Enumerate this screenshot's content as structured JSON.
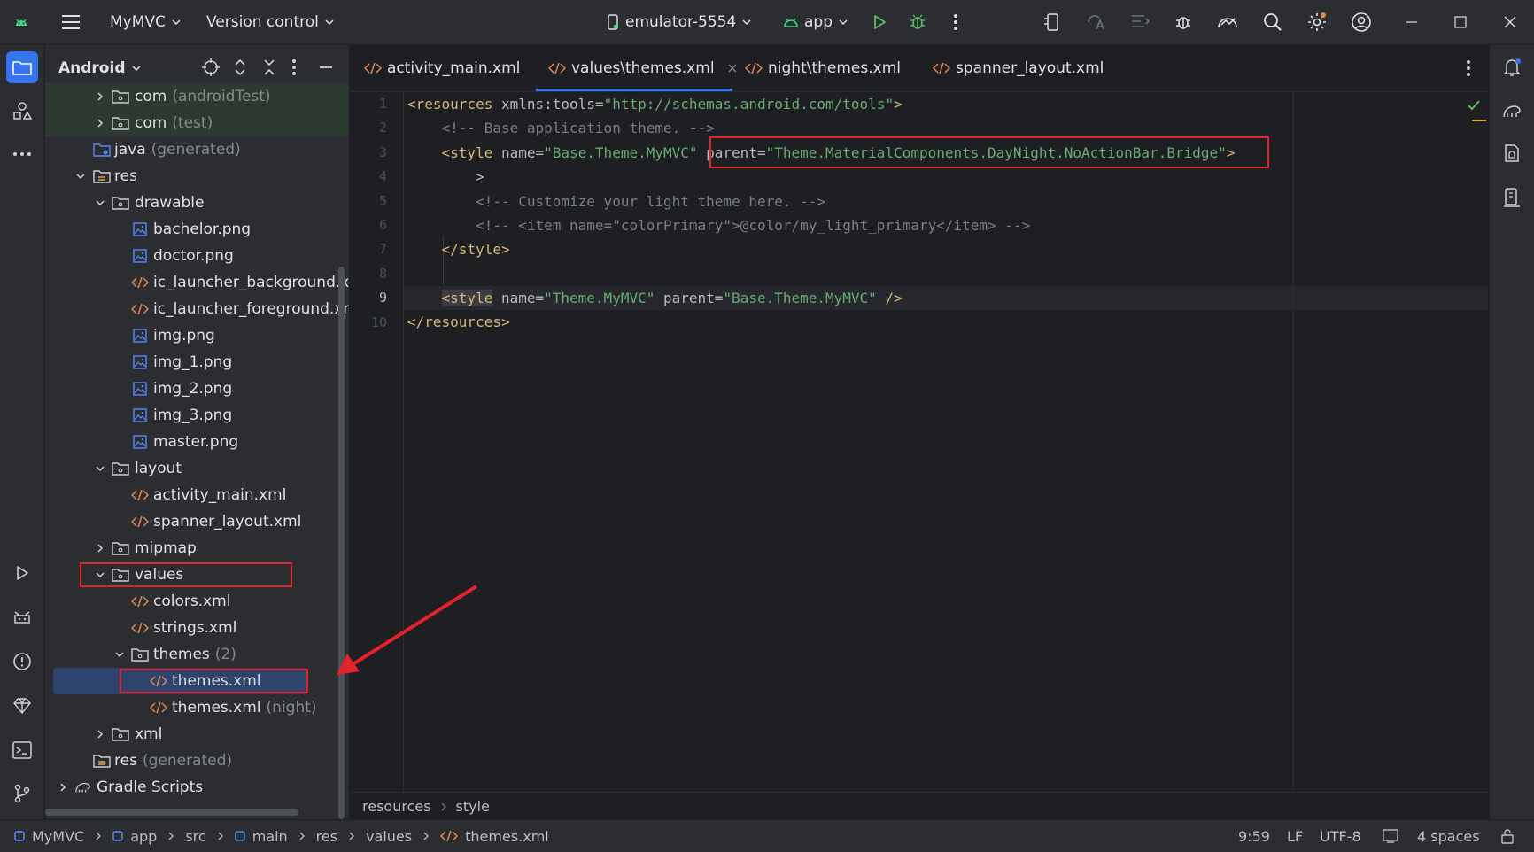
{
  "titlebar": {
    "project_name": "MyMVC",
    "vcs_label": "Version control",
    "device": "emulator-5554",
    "run_config": "app"
  },
  "project_panel": {
    "view_mode": "Android",
    "tree": [
      {
        "label": "com",
        "suffix": "(androidTest)",
        "level": 2,
        "type": "package",
        "arrow": "right"
      },
      {
        "label": "com",
        "suffix": "(test)",
        "level": 2,
        "type": "package",
        "arrow": "right"
      },
      {
        "label": "java",
        "suffix": "(generated)",
        "level": 1,
        "type": "folder-gen",
        "arrow": ""
      },
      {
        "label": "res",
        "suffix": "",
        "level": 1,
        "type": "folder-res",
        "arrow": "down"
      },
      {
        "label": "drawable",
        "suffix": "",
        "level": 2,
        "type": "folder",
        "arrow": "down"
      },
      {
        "label": "bachelor.png",
        "suffix": "",
        "level": 3,
        "type": "image",
        "arrow": ""
      },
      {
        "label": "doctor.png",
        "suffix": "",
        "level": 3,
        "type": "image",
        "arrow": ""
      },
      {
        "label": "ic_launcher_background.xml",
        "suffix": "",
        "level": 3,
        "type": "xml",
        "arrow": ""
      },
      {
        "label": "ic_launcher_foreground.xml",
        "suffix": "",
        "level": 3,
        "type": "xml",
        "arrow": ""
      },
      {
        "label": "img.png",
        "suffix": "",
        "level": 3,
        "type": "image",
        "arrow": ""
      },
      {
        "label": "img_1.png",
        "suffix": "",
        "level": 3,
        "type": "image",
        "arrow": ""
      },
      {
        "label": "img_2.png",
        "suffix": "",
        "level": 3,
        "type": "image",
        "arrow": ""
      },
      {
        "label": "img_3.png",
        "suffix": "",
        "level": 3,
        "type": "image",
        "arrow": ""
      },
      {
        "label": "master.png",
        "suffix": "",
        "level": 3,
        "type": "image",
        "arrow": ""
      },
      {
        "label": "layout",
        "suffix": "",
        "level": 2,
        "type": "folder",
        "arrow": "down"
      },
      {
        "label": "activity_main.xml",
        "suffix": "",
        "level": 3,
        "type": "xml",
        "arrow": ""
      },
      {
        "label": "spanner_layout.xml",
        "suffix": "",
        "level": 3,
        "type": "xml",
        "arrow": ""
      },
      {
        "label": "mipmap",
        "suffix": "",
        "level": 2,
        "type": "folder",
        "arrow": "right"
      },
      {
        "label": "values",
        "suffix": "",
        "level": 2,
        "type": "folder",
        "arrow": "down",
        "highlight": true
      },
      {
        "label": "colors.xml",
        "suffix": "",
        "level": 3,
        "type": "xml",
        "arrow": ""
      },
      {
        "label": "strings.xml",
        "suffix": "",
        "level": 3,
        "type": "xml",
        "arrow": ""
      },
      {
        "label": "themes",
        "suffix": "(2)",
        "level": 3,
        "type": "folder",
        "arrow": "down"
      },
      {
        "label": "themes.xml",
        "suffix": "",
        "level": 4,
        "type": "xml",
        "arrow": "",
        "selected": true,
        "highlight": true
      },
      {
        "label": "themes.xml",
        "suffix": "(night)",
        "level": 4,
        "type": "xml",
        "arrow": ""
      },
      {
        "label": "xml",
        "suffix": "",
        "level": 2,
        "type": "folder",
        "arrow": "right"
      },
      {
        "label": "res",
        "suffix": "(generated)",
        "level": 1,
        "type": "folder-res",
        "arrow": ""
      },
      {
        "label": "Gradle Scripts",
        "suffix": "",
        "level": 0,
        "type": "gradle",
        "arrow": "right"
      }
    ]
  },
  "tabs": [
    {
      "label": "activity_main.xml",
      "active": false
    },
    {
      "label": "values\\themes.xml",
      "active": true
    },
    {
      "label": "night\\themes.xml",
      "active": false
    },
    {
      "label": "spanner_layout.xml",
      "active": false
    }
  ],
  "editor": {
    "line_numbers": [
      "1",
      "2",
      "3",
      "4",
      "5",
      "6",
      "7",
      "8",
      "9",
      "10"
    ],
    "lines": {
      "l1": {
        "open": "<resources",
        "attr": " xmlns:tools=",
        "val": "\"http://schemas.android.com/tools\"",
        "close": ">"
      },
      "l2": {
        "comment": "    <!-- Base application theme. -->"
      },
      "l3": {
        "indent": "    ",
        "open": "<style",
        "attr1": " name=",
        "val1": "\"Base.Theme.MyMVC\"",
        "attr2": " parent=",
        "val2": "\"Theme.MaterialComponents.DayNight.NoActionBar.Bridge\"",
        "close": ">"
      },
      "l4": {
        "text": "        >"
      },
      "l5": {
        "comment": "        <!-- Customize your light theme here. -->"
      },
      "l6": {
        "comment": "        <!-- <item name=\"colorPrimary\">@color/my_light_primary</item> -->"
      },
      "l7": {
        "indent": "    ",
        "tag": "</style>"
      },
      "l9": {
        "indent": "    ",
        "open": "<style",
        "attr1": " name=",
        "val1": "\"Theme.MyMVC\"",
        "attr2": " parent=",
        "val2": "\"Base.Theme.MyMVC\"",
        "close": " />"
      },
      "l10": {
        "tag": "</resources>"
      }
    }
  },
  "editor_breadcrumb": [
    "resources",
    "style"
  ],
  "statusbar": {
    "path": [
      "MyMVC",
      "app",
      "src",
      "main",
      "res",
      "values",
      "themes.xml"
    ],
    "caret": "9:59",
    "line_sep": "LF",
    "encoding": "UTF-8",
    "indent": "4 spaces"
  },
  "colors": {
    "accent": "#3574f0",
    "selection": "#2e436e",
    "annotation": "#e3222b",
    "xml_icon": "#e08855",
    "image_icon": "#548af7"
  }
}
